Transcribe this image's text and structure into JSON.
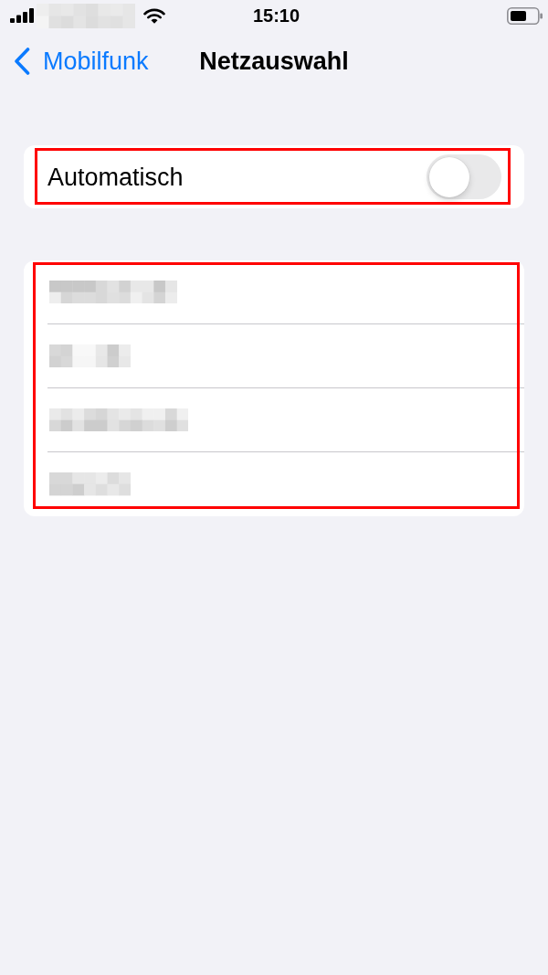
{
  "status_bar": {
    "carrier": {
      "kind": "pixelated"
    },
    "time": "15:10"
  },
  "nav_bar": {
    "back_label": "Mobilfunk",
    "title": "Netzauswahl"
  },
  "automatic": {
    "label": "Automatisch",
    "on": false,
    "highlighted": true
  },
  "networks": {
    "highlighted": true,
    "items": [
      {
        "kind": "pixelated"
      },
      {
        "kind": "pixelated"
      },
      {
        "kind": "pixelated"
      },
      {
        "kind": "pixelated"
      }
    ]
  }
}
